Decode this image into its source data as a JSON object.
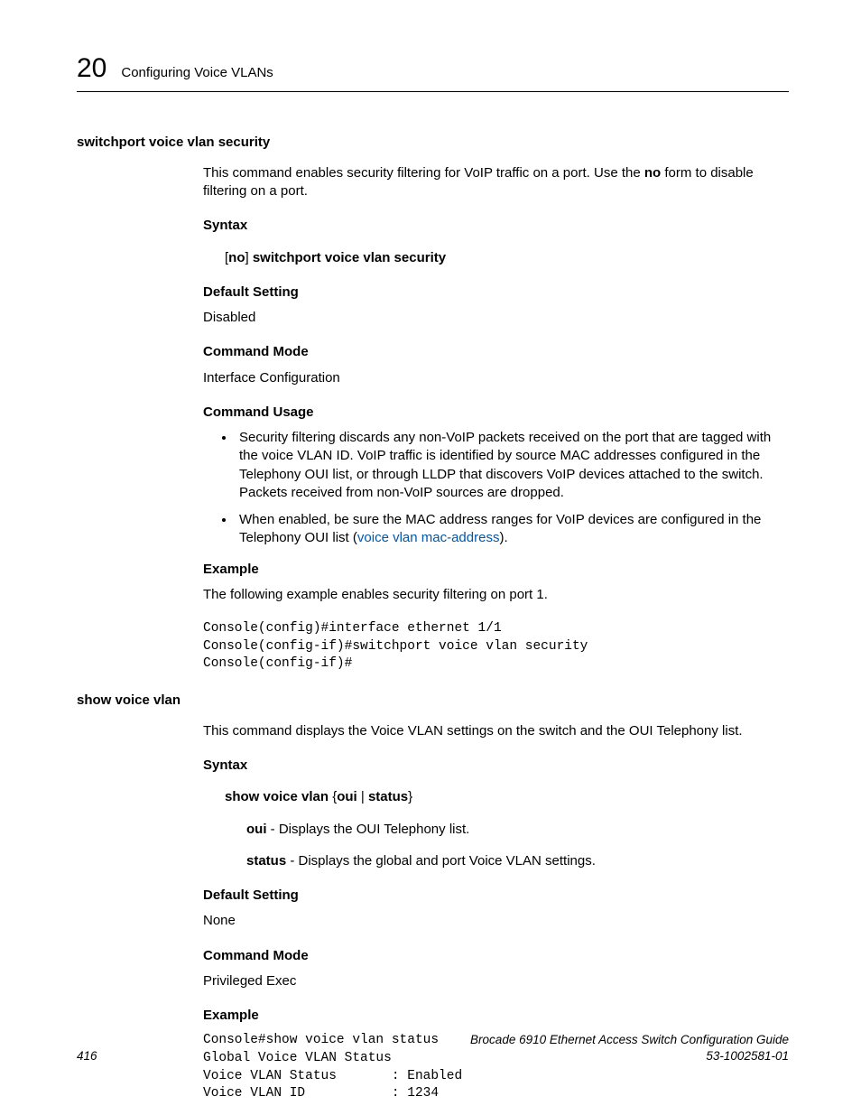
{
  "header": {
    "chapter_num": "20",
    "chapter_title": "Configuring Voice VLANs"
  },
  "cmd1": {
    "name": "switchport voice vlan security",
    "desc_pre": "This command enables security filtering for VoIP traffic on a port. Use the ",
    "desc_bold": "no",
    "desc_post": " form to disable filtering on a port.",
    "syntax_label": "Syntax",
    "syntax_br1": "[",
    "syntax_no": "no",
    "syntax_br2": "] ",
    "syntax_cmd": "switchport voice vlan security",
    "default_label": "Default Setting",
    "default_val": "Disabled",
    "mode_label": "Command Mode",
    "mode_val": "Interface Configuration",
    "usage_label": "Command Usage",
    "usage1": "Security filtering discards any non-VoIP packets received on the port that are tagged with the voice VLAN ID. VoIP traffic is identified by source MAC addresses configured in the Telephony OUI list, or through LLDP that discovers VoIP devices attached to the switch. Packets received from non-VoIP sources are dropped.",
    "usage2_pre": "When enabled, be sure the MAC address ranges for VoIP devices are configured in the Telephony OUI list (",
    "usage2_link": "voice vlan mac-address",
    "usage2_post": ").",
    "example_label": "Example",
    "example_desc": "The following example enables security filtering on port 1.",
    "example_code": "Console(config)#interface ethernet 1/1\nConsole(config-if)#switchport voice vlan security\nConsole(config-if)#"
  },
  "cmd2": {
    "name": "show voice vlan",
    "desc": "This command displays the Voice VLAN settings on the switch and the OUI Telephony list.",
    "syntax_label": "Syntax",
    "syntax_cmd": "show voice vlan",
    "syntax_br1": " {",
    "syntax_opt1": "oui",
    "syntax_sep": " | ",
    "syntax_opt2": "status",
    "syntax_br2": "}",
    "param1_name": "oui",
    "param1_desc": " - Displays the OUI Telephony list.",
    "param2_name": "status",
    "param2_desc": " - Displays the global and port Voice VLAN settings.",
    "default_label": "Default Setting",
    "default_val": "None",
    "mode_label": "Command Mode",
    "mode_val": "Privileged Exec",
    "example_label": "Example",
    "example_code": "Console#show voice vlan status\nGlobal Voice VLAN Status\nVoice VLAN Status       : Enabled\nVoice VLAN ID           : 1234"
  },
  "footer": {
    "page": "416",
    "title": "Brocade 6910 Ethernet Access Switch Configuration Guide",
    "docnum": "53-1002581-01"
  }
}
